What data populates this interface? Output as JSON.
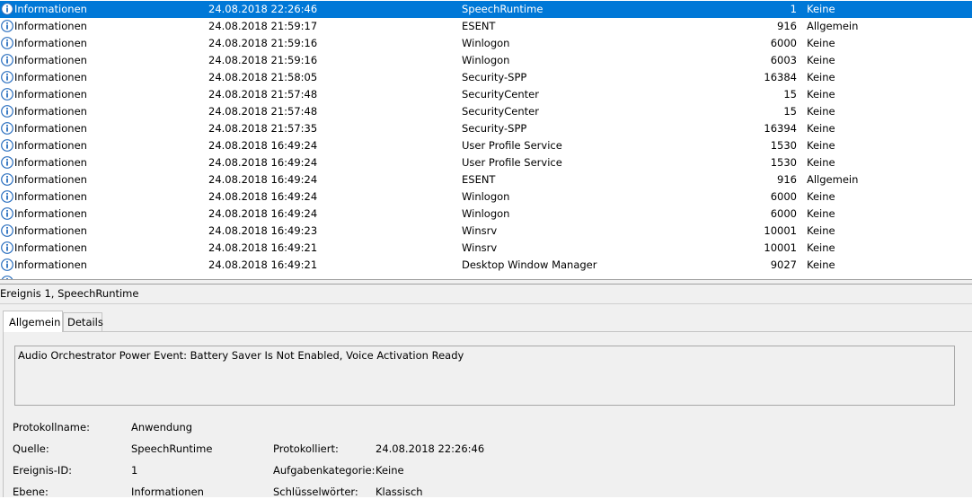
{
  "events": [
    {
      "level": "Informationen",
      "date": "24.08.2018 22:26:46",
      "source": "SpeechRuntime",
      "id": "1",
      "task": "Keine",
      "selected": true
    },
    {
      "level": "Informationen",
      "date": "24.08.2018 21:59:17",
      "source": "ESENT",
      "id": "916",
      "task": "Allgemein"
    },
    {
      "level": "Informationen",
      "date": "24.08.2018 21:59:16",
      "source": "Winlogon",
      "id": "6000",
      "task": "Keine"
    },
    {
      "level": "Informationen",
      "date": "24.08.2018 21:59:16",
      "source": "Winlogon",
      "id": "6003",
      "task": "Keine"
    },
    {
      "level": "Informationen",
      "date": "24.08.2018 21:58:05",
      "source": "Security-SPP",
      "id": "16384",
      "task": "Keine"
    },
    {
      "level": "Informationen",
      "date": "24.08.2018 21:57:48",
      "source": "SecurityCenter",
      "id": "15",
      "task": "Keine"
    },
    {
      "level": "Informationen",
      "date": "24.08.2018 21:57:48",
      "source": "SecurityCenter",
      "id": "15",
      "task": "Keine"
    },
    {
      "level": "Informationen",
      "date": "24.08.2018 21:57:35",
      "source": "Security-SPP",
      "id": "16394",
      "task": "Keine"
    },
    {
      "level": "Informationen",
      "date": "24.08.2018 16:49:24",
      "source": "User Profile Service",
      "id": "1530",
      "task": "Keine"
    },
    {
      "level": "Informationen",
      "date": "24.08.2018 16:49:24",
      "source": "User Profile Service",
      "id": "1530",
      "task": "Keine"
    },
    {
      "level": "Informationen",
      "date": "24.08.2018 16:49:24",
      "source": "ESENT",
      "id": "916",
      "task": "Allgemein"
    },
    {
      "level": "Informationen",
      "date": "24.08.2018 16:49:24",
      "source": "Winlogon",
      "id": "6000",
      "task": "Keine"
    },
    {
      "level": "Informationen",
      "date": "24.08.2018 16:49:24",
      "source": "Winlogon",
      "id": "6000",
      "task": "Keine"
    },
    {
      "level": "Informationen",
      "date": "24.08.2018 16:49:23",
      "source": "Winsrv",
      "id": "10001",
      "task": "Keine"
    },
    {
      "level": "Informationen",
      "date": "24.08.2018 16:49:21",
      "source": "Winsrv",
      "id": "10001",
      "task": "Keine"
    },
    {
      "level": "Informationen",
      "date": "24.08.2018 16:49:21",
      "source": "Desktop Window Manager",
      "id": "9027",
      "task": "Keine"
    }
  ],
  "row_icon": "info-icon",
  "colors": {
    "selection": "#0078d7",
    "panel": "#f0f0f0",
    "icon_blue": "#2a6fbf"
  },
  "detail": {
    "title": "Ereignis 1, SpeechRuntime",
    "tabs": [
      "Allgemein",
      "Details"
    ],
    "message": "Audio Orchestrator Power Event: Battery Saver Is Not Enabled, Voice Activation Ready",
    "props": {
      "log_name_label": "Protokollname:",
      "log_name": "Anwendung",
      "source_label": "Quelle:",
      "source": "SpeechRuntime",
      "logged_label": "Protokolliert:",
      "logged": "24.08.2018 22:26:46",
      "event_id_label": "Ereignis-ID:",
      "event_id": "1",
      "task_label": "Aufgabenkategorie:",
      "task": "Keine",
      "level_label": "Ebene:",
      "level": "Informationen",
      "keywords_label": "Schlüsselwörter:",
      "keywords": "Klassisch"
    }
  }
}
